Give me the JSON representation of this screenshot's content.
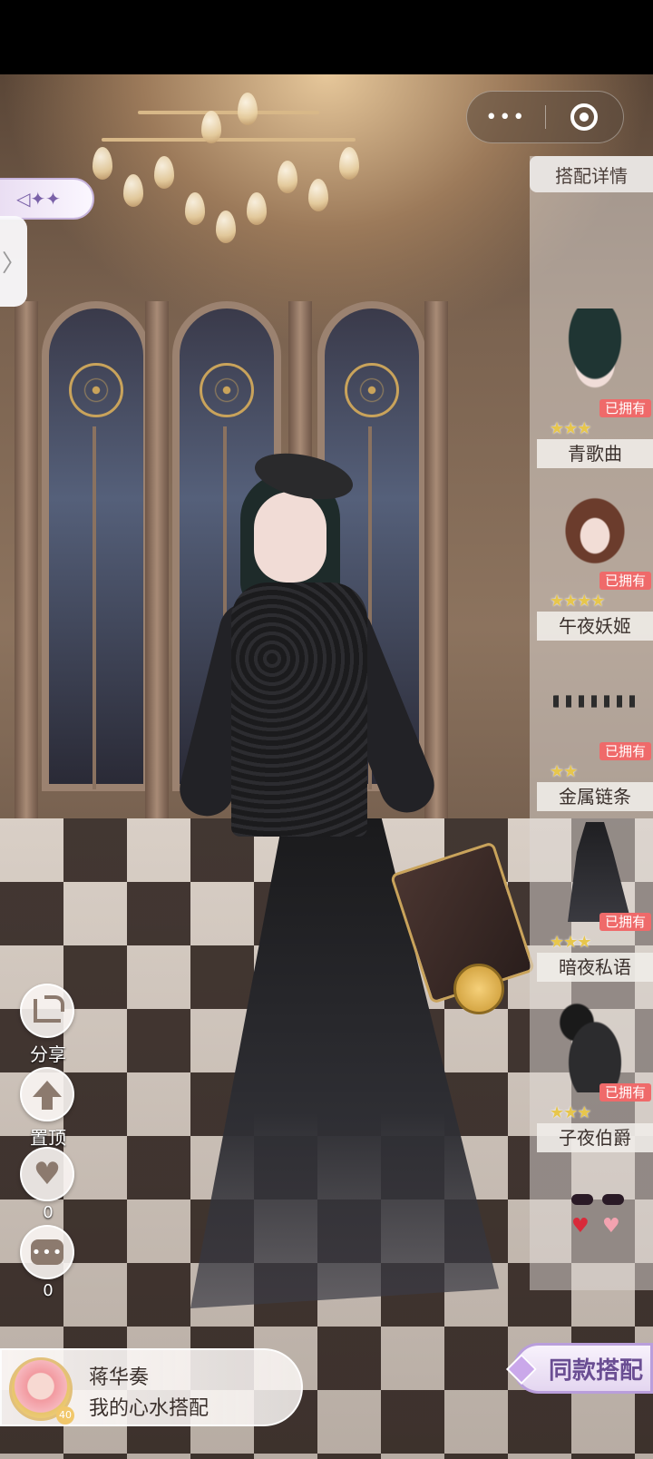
{
  "top_bar": {
    "more_label": "•••"
  },
  "back": {
    "label": "◁✦✦",
    "side_tab_glyph": "〉"
  },
  "panel": {
    "title": "搭配详情",
    "items": [
      {
        "name": "青歌曲",
        "owned": "已拥有",
        "stars": "★★★"
      },
      {
        "name": "午夜妖姬",
        "owned": "已拥有",
        "stars": "★★★★"
      },
      {
        "name": "金属链条",
        "owned": "已拥有",
        "stars": "★★"
      },
      {
        "name": "暗夜私语",
        "owned": "已拥有",
        "stars": "★★★"
      },
      {
        "name": "子夜伯爵",
        "owned": "已拥有",
        "stars": "★★★"
      }
    ],
    "earring_glyph": "♥"
  },
  "actions": {
    "share_label": "分享",
    "pin_label": "置顶",
    "like_count": "0",
    "comment_count": "0",
    "comment_glyph": "•••",
    "like_glyph": "♥"
  },
  "user": {
    "name": "蒋华奏",
    "subtitle": "我的心水搭配",
    "level": "40"
  },
  "same_outfit_button": "同款搭配",
  "colors": {
    "owned_badge": "#ef6a6a",
    "star": "#e7c64c",
    "accent_purple": "#6a4e93"
  }
}
